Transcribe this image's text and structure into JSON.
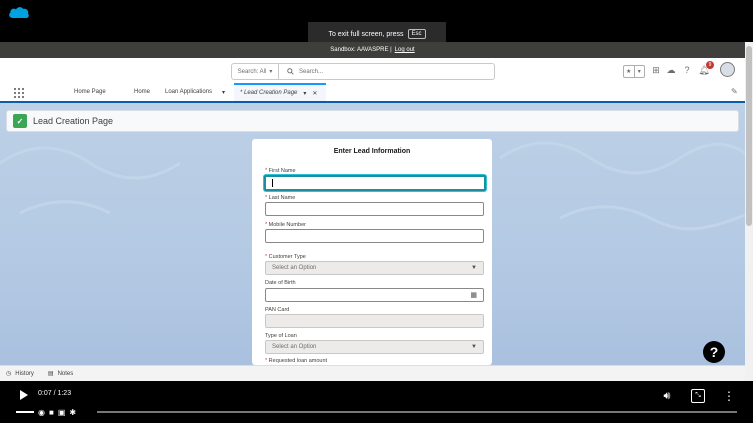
{
  "fullscreen_toast": {
    "text": "To exit full screen, press",
    "key": "Esc"
  },
  "sandbox_bar": {
    "text": "Sandbox: AAVASPRE |",
    "logout": "Log out"
  },
  "header": {
    "search_scope": "Search: All",
    "search_placeholder": "Search...",
    "notification_count": "9"
  },
  "nav": {
    "app_name": "Home Page",
    "items": [
      "Home",
      "Loan Applications"
    ],
    "active_tab": "* Lead Creation Page"
  },
  "page": {
    "title": "Lead Creation Page"
  },
  "form": {
    "title": "Enter Lead Information",
    "fields": [
      {
        "label": "First Name",
        "required": true,
        "value": ""
      },
      {
        "label": "Last Name",
        "required": true,
        "value": ""
      },
      {
        "label": "Mobile Number",
        "required": true,
        "value": ""
      },
      {
        "label": "Customer Type",
        "required": true,
        "value": "Select an Option"
      },
      {
        "label": "Date of Birth",
        "required": false,
        "value": ""
      },
      {
        "label": "PAN Card",
        "required": false,
        "value": ""
      },
      {
        "label": "Type of Loan",
        "required": false,
        "value": "Select an Option"
      },
      {
        "label": "Requested loan amount",
        "required": true,
        "value": ""
      }
    ]
  },
  "utility_bar": {
    "items": [
      "History",
      "Notes"
    ]
  },
  "player": {
    "time": "0:07 / 1:23"
  }
}
